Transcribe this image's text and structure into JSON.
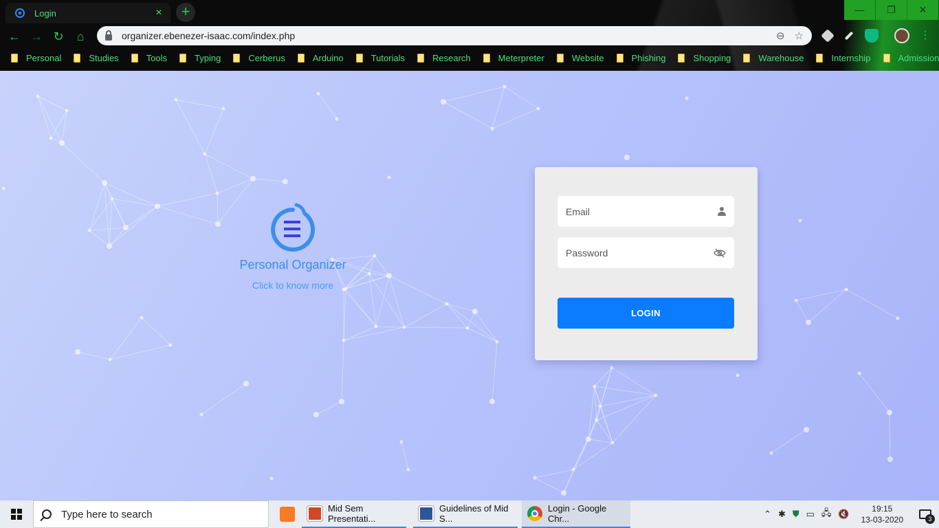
{
  "browser": {
    "tab_title": "Login",
    "tab_close": "×",
    "new_tab": "+",
    "url": "organizer.ebenezer-isaac.com/index.php",
    "window_controls": {
      "minimize": "—",
      "maximize": "❐",
      "close": "✕"
    },
    "nav": {
      "back": "←",
      "forward": "→",
      "reload": "↻",
      "home": "⌂",
      "menu": "⋮"
    },
    "bookmarks": [
      "Personal",
      "Studies",
      "Tools",
      "Typing",
      "Cerberus",
      "Arduino",
      "Tutorials",
      "Research",
      "Meterpreter",
      "Website",
      "Phishing",
      "Shopping",
      "Warehouse",
      "Internship",
      "Admission"
    ]
  },
  "page": {
    "brand_name": "Personal Organizer",
    "brand_link": "Click to know more",
    "login": {
      "email_placeholder": "Email",
      "password_placeholder": "Password",
      "button_label": "LOGIN"
    }
  },
  "taskbar": {
    "search_placeholder": "Type here to search",
    "apps": [
      {
        "label": "Mid Sem Presentati...",
        "icon": "powerpoint-icon"
      },
      {
        "label": "Guidelines of Mid S...",
        "icon": "word-icon"
      },
      {
        "label": "Login - Google Chr...",
        "icon": "chrome-icon"
      }
    ],
    "time": "19:15",
    "date": "13-03-2020",
    "notification_count": "3",
    "tray_icons": {
      "chevron": "⌃",
      "network": "🖧",
      "volume": "🔇"
    }
  },
  "colors": {
    "accent_green": "#4ade80",
    "login_button": "#0a7cff",
    "brand_blue": "#3b8fe8"
  }
}
